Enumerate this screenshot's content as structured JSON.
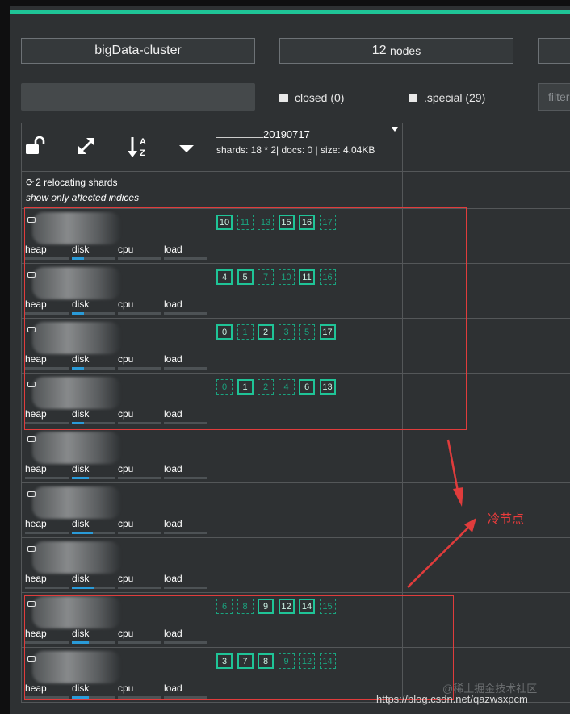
{
  "header": {
    "cluster_name": "bigData-cluster",
    "nodes_count": "12",
    "nodes_label": "nodes"
  },
  "filters": {
    "closed_label": "closed (0)",
    "special_label": ".special (29)",
    "filter_placeholder": "filter"
  },
  "toolbar": {
    "icons": [
      "unlock-icon",
      "expand-icon",
      "sort-az-icon",
      "dropdown-caret-icon"
    ]
  },
  "index": {
    "name_suffix": "20190717",
    "stats": "shards: 18 * 2| docs: 0 | size: 4.04KB"
  },
  "relocating": {
    "text": "2 relocating shards",
    "affected_text": "show only affected indices"
  },
  "metrics": {
    "heap": "heap",
    "disk": "disk",
    "cpu": "cpu",
    "load": "load"
  },
  "nodes": [
    {
      "disk_fill": 0.28,
      "shards": [
        {
          "n": "10",
          "p": true
        },
        {
          "n": "11",
          "p": false
        },
        {
          "n": "13",
          "p": false
        },
        {
          "n": "15",
          "p": true
        },
        {
          "n": "16",
          "p": true
        },
        {
          "n": "17",
          "p": false
        }
      ]
    },
    {
      "disk_fill": 0.28,
      "shards": [
        {
          "n": "4",
          "p": true
        },
        {
          "n": "5",
          "p": true
        },
        {
          "n": "7",
          "p": false
        },
        {
          "n": "10",
          "p": false
        },
        {
          "n": "11",
          "p": true
        },
        {
          "n": "16",
          "p": false
        }
      ]
    },
    {
      "disk_fill": 0.28,
      "shards": [
        {
          "n": "0",
          "p": true
        },
        {
          "n": "1",
          "p": false
        },
        {
          "n": "2",
          "p": true
        },
        {
          "n": "3",
          "p": false
        },
        {
          "n": "5",
          "p": false
        },
        {
          "n": "17",
          "p": true
        }
      ]
    },
    {
      "disk_fill": 0.28,
      "shards": [
        {
          "n": "0",
          "p": false
        },
        {
          "n": "1",
          "p": true
        },
        {
          "n": "2",
          "p": false
        },
        {
          "n": "4",
          "p": false
        },
        {
          "n": "6",
          "p": true
        },
        {
          "n": "13",
          "p": true
        }
      ]
    },
    {
      "disk_fill": 0.38,
      "shards": []
    },
    {
      "disk_fill": 0.48,
      "shards": []
    },
    {
      "disk_fill": 0.52,
      "shards": []
    },
    {
      "disk_fill": 0.38,
      "shards": [
        {
          "n": "6",
          "p": false
        },
        {
          "n": "8",
          "p": false
        },
        {
          "n": "9",
          "p": true
        },
        {
          "n": "12",
          "p": true
        },
        {
          "n": "14",
          "p": true
        },
        {
          "n": "15",
          "p": false
        }
      ]
    },
    {
      "disk_fill": 0.38,
      "shards": [
        {
          "n": "3",
          "p": true
        },
        {
          "n": "7",
          "p": true
        },
        {
          "n": "8",
          "p": true
        },
        {
          "n": "9",
          "p": false
        },
        {
          "n": "12",
          "p": false
        },
        {
          "n": "14",
          "p": false
        }
      ]
    }
  ],
  "annotation": {
    "cold_nodes_label": "冷节点"
  },
  "watermark": {
    "line1": "@稀土掘金技术社区",
    "line2": "https://blog.csdn.net/qazwsxpcm"
  },
  "colors": {
    "accent": "#1fc497",
    "disk_bar": "#2a9bd8",
    "annotation_red": "#e03c3c"
  }
}
